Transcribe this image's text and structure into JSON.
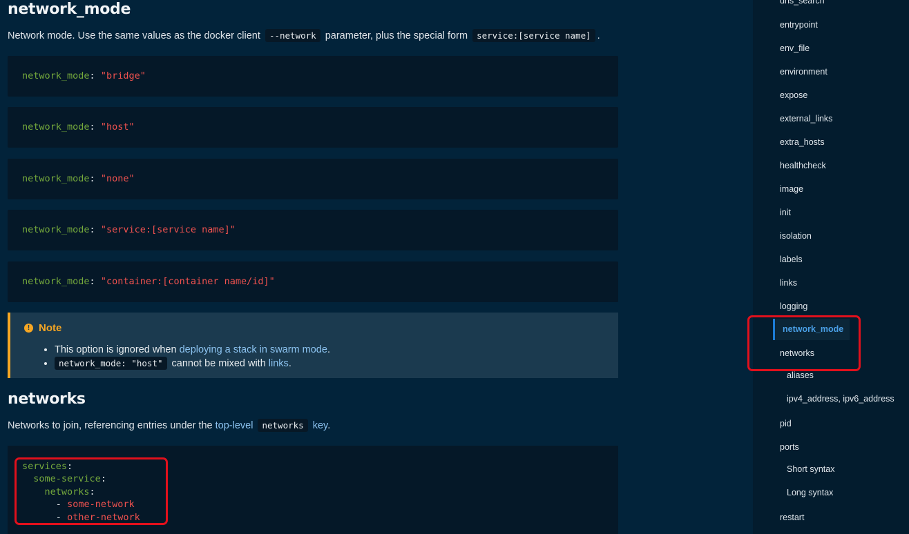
{
  "network_mode_section": {
    "heading": "network_mode",
    "intro_before": "Network mode. Use the same values as the docker client",
    "intro_code_1": "--network",
    "intro_middle": "parameter, plus the special form",
    "intro_code_2": "service:[service name]",
    "intro_after": ".",
    "examples": [
      {
        "key": "network_mode",
        "value": "\"bridge\""
      },
      {
        "key": "network_mode",
        "value": "\"host\""
      },
      {
        "key": "network_mode",
        "value": "\"none\""
      },
      {
        "key": "network_mode",
        "value": "\"service:[service name]\""
      },
      {
        "key": "network_mode",
        "value": "\"container:[container name/id]\""
      }
    ]
  },
  "note": {
    "title": "Note",
    "item1_before": "This option is ignored when",
    "item1_link": "deploying a stack in swarm mode",
    "item1_after": ".",
    "item2_code": "network_mode: \"host\"",
    "item2_middle": "cannot be mixed with",
    "item2_link": "links",
    "item2_after": "."
  },
  "networks_section": {
    "heading": "networks",
    "intro_before": "Networks to join, referencing entries under the",
    "intro_link": "top-level",
    "intro_code": "networks",
    "intro_link_2": "key",
    "intro_after": ".",
    "code": {
      "l1_key": "services",
      "l2_key": "some-service",
      "l3_key": "networks",
      "dash": "-",
      "item1": "some-network",
      "item2": "other-network"
    }
  },
  "sidebar": {
    "items": [
      "dns_search",
      "entrypoint",
      "env_file",
      "environment",
      "expose",
      "external_links",
      "extra_hosts",
      "healthcheck",
      "image",
      "init",
      "isolation",
      "labels",
      "links",
      "logging"
    ],
    "active_item": "network_mode",
    "networks": "networks",
    "networks_sub": [
      "aliases",
      "ipv4_address, ipv6_address"
    ],
    "pid": "pid",
    "ports": "ports",
    "ports_sub": [
      "Short syntax",
      "Long syntax"
    ],
    "restart": "restart"
  },
  "colors": {
    "background": "#02233a",
    "sidebar_bg": "#031c2e",
    "code_key": "#74a83c",
    "code_string": "#f0524f",
    "link": "#8cc3f0",
    "note_accent": "#f5a623",
    "active_accent": "#1c7cd6",
    "highlight_box": "#e2101c"
  }
}
